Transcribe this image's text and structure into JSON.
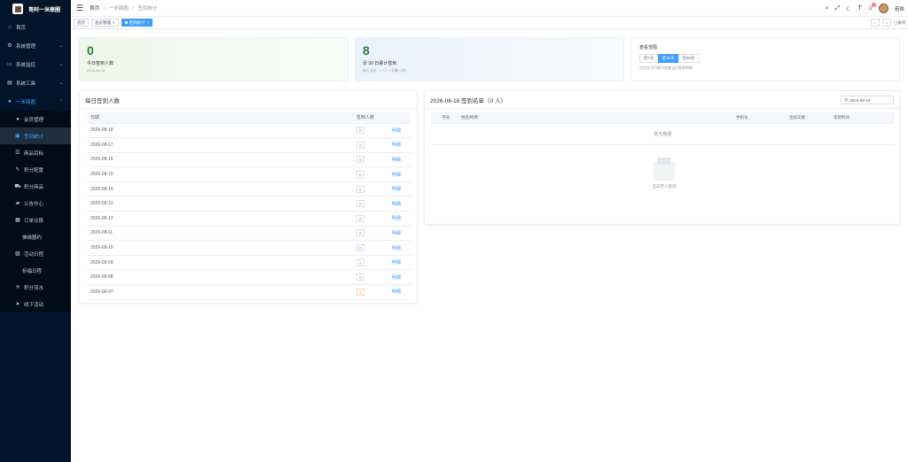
{
  "app": {
    "title": "哥阿一米鼎圈"
  },
  "sidebar": {
    "items": [
      {
        "label": "首页",
        "icon": "home-icon"
      },
      {
        "label": "系统管理",
        "icon": "gear-icon"
      },
      {
        "label": "系统监控",
        "icon": "monitor-icon"
      },
      {
        "label": "系统工具",
        "icon": "tool-icon"
      },
      {
        "label": "一米鼎圈",
        "icon": "group-icon"
      }
    ],
    "subitems": [
      {
        "label": "会员管理",
        "icon": "user-icon"
      },
      {
        "label": "签到统计",
        "icon": "stats-icon"
      },
      {
        "label": "商品目标",
        "icon": "list-icon"
      },
      {
        "label": "积分配置",
        "icon": "edit-icon"
      },
      {
        "label": "积分商品",
        "icon": "cart-icon"
      },
      {
        "label": "公告中心",
        "icon": "chat-icon"
      },
      {
        "label": "订单兑换",
        "icon": "doc-icon"
      },
      {
        "label": "佛缘圈约",
        "icon": ""
      },
      {
        "label": "活动日程",
        "icon": "note-icon"
      },
      {
        "label": "祈福日程",
        "icon": ""
      },
      {
        "label": "积分流水",
        "icon": "star-icon"
      },
      {
        "label": "线下活动",
        "icon": "send-icon"
      }
    ]
  },
  "header": {
    "breadcrumb": [
      "首页",
      "一米鼎圈",
      "签到统计"
    ],
    "notification_count": "3",
    "user_name": "若依"
  },
  "tags": {
    "items": [
      "首页",
      "会员管理",
      "签到统计"
    ],
    "active_index": 2,
    "close_others": "关闭"
  },
  "stats": {
    "today": {
      "value": "0",
      "label": "今日签到人数",
      "sub": "2026-08-18"
    },
    "recent": {
      "value": "8",
      "label": "近 30 日累计签到",
      "sub": "按人次计（一人一天算一次）"
    }
  },
  "range": {
    "title": "查看范围",
    "options": [
      "近7天",
      "近30天",
      "近90天"
    ],
    "selected": 1,
    "hint": "点击左方日期可查看当日签到明细"
  },
  "daily": {
    "title": "每日签到人数",
    "columns": [
      "日期",
      "签到人数",
      ""
    ],
    "action_label": "明细",
    "rows": [
      {
        "date": "2026-08-18",
        "count": "0"
      },
      {
        "date": "2026-08-17",
        "count": "0"
      },
      {
        "date": "2026-08-16",
        "count": "0"
      },
      {
        "date": "2026-08-15",
        "count": "0"
      },
      {
        "date": "2026-08-14",
        "count": "0"
      },
      {
        "date": "2026-08-13",
        "count": "0"
      },
      {
        "date": "2026-08-12",
        "count": "0"
      },
      {
        "date": "2026-08-11",
        "count": "0"
      },
      {
        "date": "2026-08-10",
        "count": "0"
      },
      {
        "date": "2026-08-09",
        "count": "0"
      },
      {
        "date": "2026-08-08",
        "count": "0"
      },
      {
        "date": "2026-08-07",
        "count": "2"
      }
    ]
  },
  "signlist": {
    "title": "2026-08-18 签到名单（0 人）",
    "date_value": "2026-08-18",
    "columns": [
      "序号",
      "姓名/昵称",
      "手机号",
      "连续天数",
      "签到时间"
    ],
    "empty_row": "暂无数据",
    "empty_text": "当日无人签到"
  }
}
